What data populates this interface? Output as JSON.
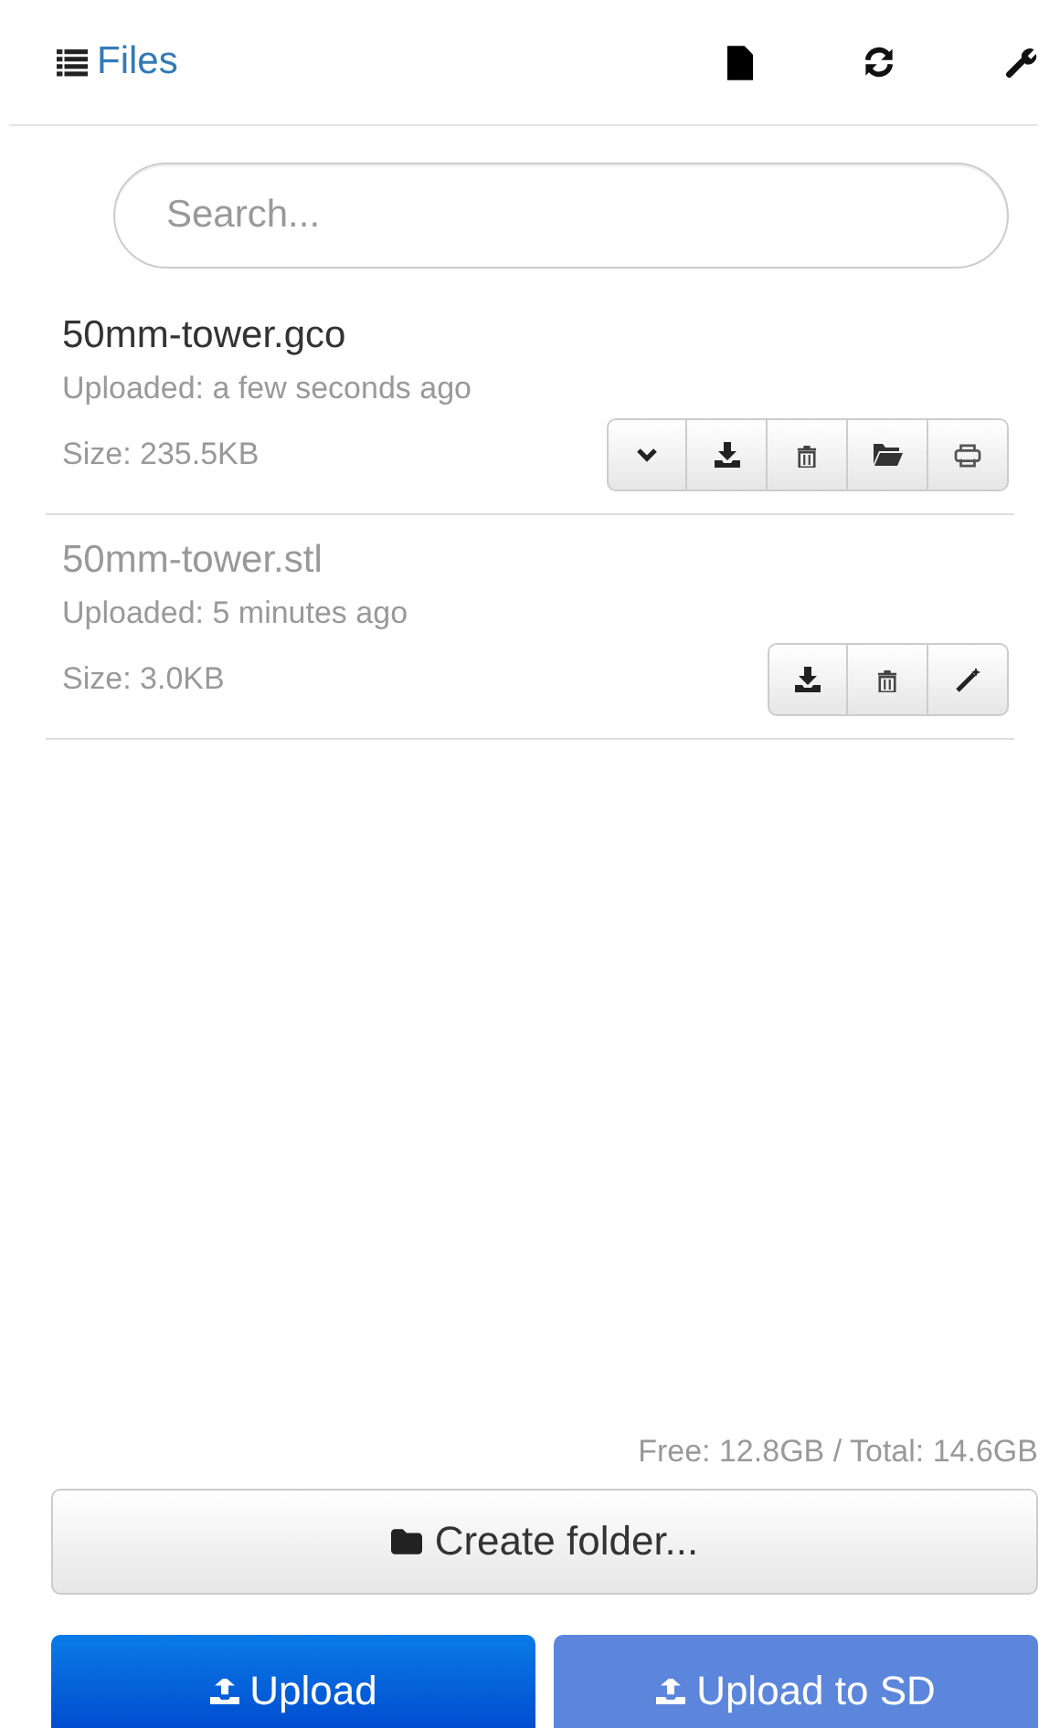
{
  "header": {
    "title": "Files"
  },
  "search": {
    "placeholder": "Search..."
  },
  "files": [
    {
      "name": "50mm-tower.gco",
      "kind": "machinecode",
      "uploaded": "Uploaded: a few seconds ago",
      "size": "Size: 235.5KB",
      "actions": [
        {
          "kind": "details"
        },
        {
          "kind": "download"
        },
        {
          "kind": "delete"
        },
        {
          "kind": "load"
        },
        {
          "kind": "print"
        }
      ]
    },
    {
      "name": "50mm-tower.stl",
      "kind": "model",
      "uploaded": "Uploaded: 5 minutes ago",
      "size": "Size: 3.0KB",
      "actions": [
        {
          "kind": "download"
        },
        {
          "kind": "delete"
        },
        {
          "kind": "slice"
        }
      ]
    }
  ],
  "storage": "Free: 12.8GB / Total: 14.6GB",
  "create_folder": "Create folder...",
  "uploads": [
    {
      "label": "Upload",
      "disabled": false
    },
    {
      "label": "Upload to SD",
      "disabled": true
    }
  ]
}
